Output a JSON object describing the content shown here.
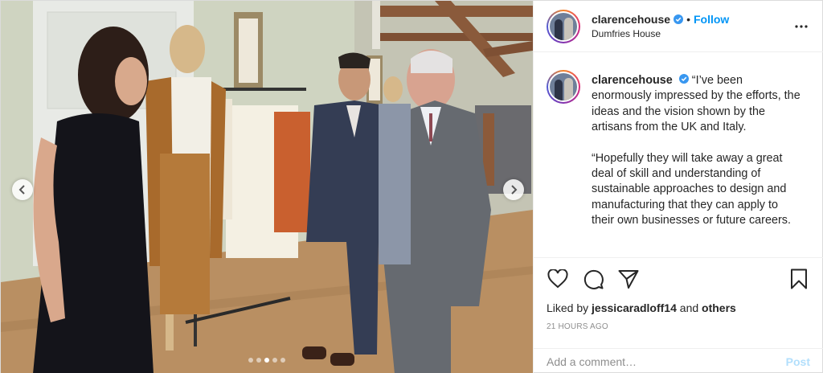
{
  "post": {
    "username": "clarencehouse",
    "follow_label": "Follow",
    "separator": "•",
    "location": "Dumfries House",
    "caption_paragraphs": [
      "“I’ve been enormously impressed by the efforts, the ideas and the vision shown by the artisans from the UK and Italy.",
      "“Hopefully they will take away a great deal of skill and understanding of sustainable approaches to design and manufacturing that they can apply to their own businesses or future careers."
    ],
    "liked_by_prefix": "Liked by",
    "liked_by_user": "jessicaradloff14",
    "liked_by_and": "and",
    "liked_by_others": "others",
    "timestamp": "21 HOURS AGO",
    "comment_placeholder": "Add a comment…",
    "post_label": "Post"
  },
  "carousel": {
    "slide_count": 5,
    "active_index": 2
  },
  "icons": {
    "verified": "verified-badge-icon",
    "more": "more-options-icon",
    "like": "heart-icon",
    "comment": "comment-icon",
    "share": "paper-plane-icon",
    "save": "bookmark-icon",
    "prev": "chevron-left-icon",
    "next": "chevron-right-icon"
  },
  "colors": {
    "accent": "#0095f6",
    "post_disabled": "#b2dffc",
    "muted": "#8e8e8e",
    "text": "#262626"
  }
}
